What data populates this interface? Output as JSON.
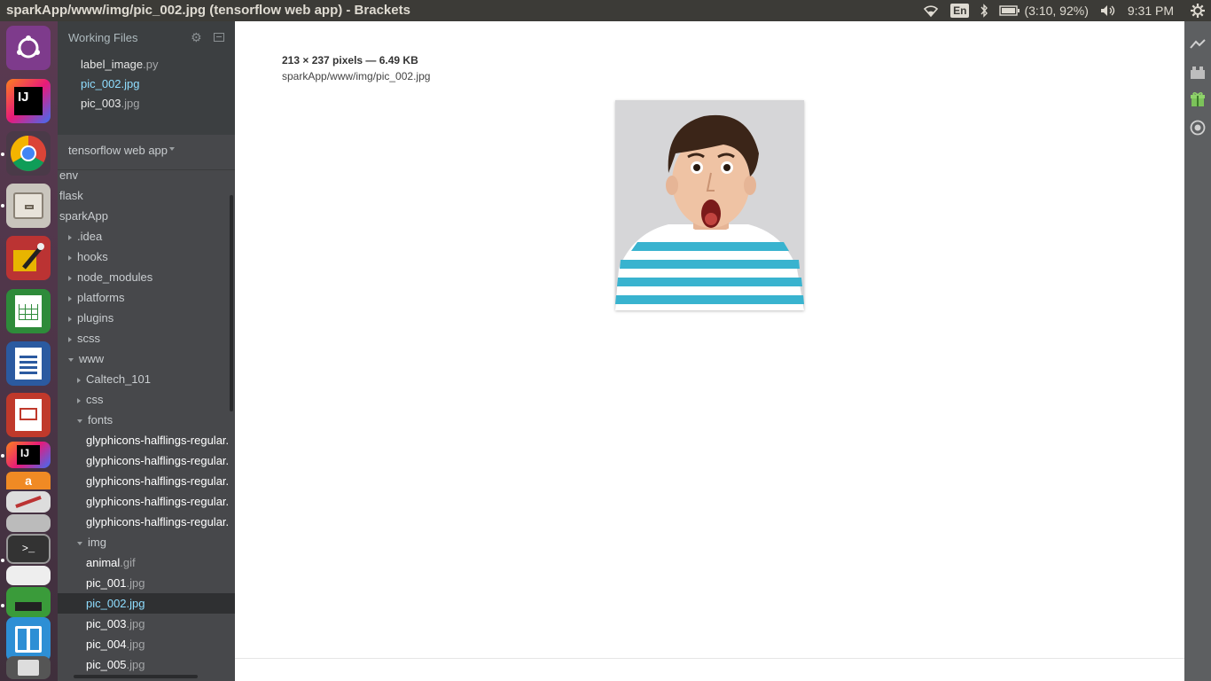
{
  "window": {
    "title": "sparkApp/www/img/pic_002.jpg (tensorflow web app) - Brackets"
  },
  "tray": {
    "keyboard": "En",
    "battery": "(3:10, 92%)",
    "clock": "9:31 PM"
  },
  "launcher": {
    "apps": [
      "ubuntu-dash",
      "intellij-idea",
      "google-chrome",
      "files",
      "gimp-like-editor",
      "libreoffice-calc",
      "libreoffice-writer",
      "libreoffice-impress",
      "intellij-idea-2",
      "amazon",
      "text-editor",
      "disk",
      "terminal",
      "text-editor-2",
      "software-center",
      "workspace-switcher",
      "trash"
    ]
  },
  "working_files": {
    "header": "Working Files",
    "items": [
      {
        "name": "label_image",
        "ext": ".py",
        "active": false
      },
      {
        "name": "pic_002",
        "ext": ".jpg",
        "active": true
      },
      {
        "name": "pic_003",
        "ext": ".jpg",
        "active": false
      }
    ]
  },
  "project": {
    "title": "tensorflow web app"
  },
  "tree": [
    {
      "name": "env",
      "ext": "",
      "type": "folder-root"
    },
    {
      "name": "flask",
      "ext": "",
      "type": "folder-root"
    },
    {
      "name": "sparkApp",
      "ext": "",
      "type": "folder-root"
    },
    {
      "name": ".idea",
      "ext": "",
      "type": "folder-closed"
    },
    {
      "name": "hooks",
      "ext": "",
      "type": "folder-closed"
    },
    {
      "name": "node_modules",
      "ext": "",
      "type": "folder-closed"
    },
    {
      "name": "platforms",
      "ext": "",
      "type": "folder-closed"
    },
    {
      "name": "plugins",
      "ext": "",
      "type": "folder-closed"
    },
    {
      "name": "scss",
      "ext": "",
      "type": "folder-closed"
    },
    {
      "name": "www",
      "ext": "",
      "type": "folder-open"
    },
    {
      "name": "Caltech_101",
      "ext": "",
      "type": "folder-closed"
    },
    {
      "name": "css",
      "ext": "",
      "type": "folder-closed"
    },
    {
      "name": "fonts",
      "ext": "",
      "type": "folder-open"
    },
    {
      "name": "glyphicons-halflings-regular.",
      "ext": "",
      "type": "file"
    },
    {
      "name": "glyphicons-halflings-regular.",
      "ext": "",
      "type": "file"
    },
    {
      "name": "glyphicons-halflings-regular.",
      "ext": "",
      "type": "file"
    },
    {
      "name": "glyphicons-halflings-regular.",
      "ext": "",
      "type": "file"
    },
    {
      "name": "glyphicons-halflings-regular.",
      "ext": "",
      "type": "file"
    },
    {
      "name": "img",
      "ext": "",
      "type": "folder-open"
    },
    {
      "name": "animal",
      "ext": ".gif",
      "type": "file"
    },
    {
      "name": "pic_001",
      "ext": ".jpg",
      "type": "file"
    },
    {
      "name": "pic_002",
      "ext": ".jpg",
      "type": "file-selected"
    },
    {
      "name": "pic_003",
      "ext": ".jpg",
      "type": "file"
    },
    {
      "name": "pic_004",
      "ext": ".jpg",
      "type": "file"
    },
    {
      "name": "pic_005",
      "ext": ".jpg",
      "type": "file"
    }
  ],
  "viewer": {
    "dimensions": "213 × 237 pixels — 6.49 KB",
    "path": "sparkApp/www/img/pic_002.jpg"
  },
  "right_toolbar": {
    "icons": [
      "live-preview-icon",
      "extension-manager-icon",
      "extension-gift-icon",
      "circle-target-icon"
    ]
  }
}
